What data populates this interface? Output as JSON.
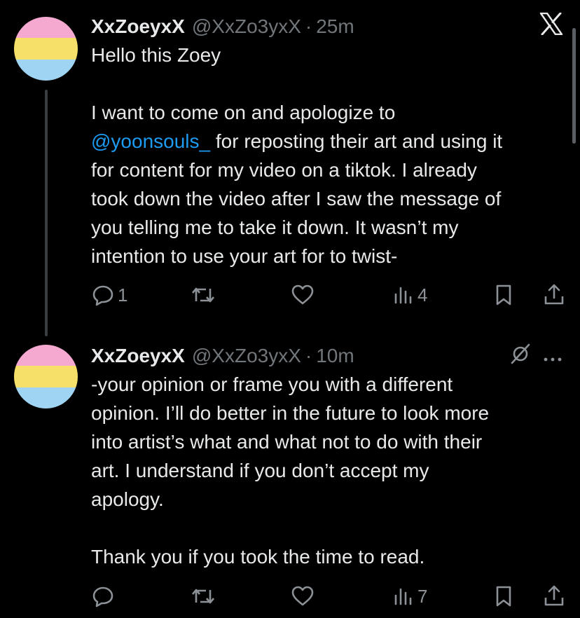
{
  "tweets": [
    {
      "display_name": "XxZoeyxX",
      "handle": "@XxZo3yxX",
      "separator": "·",
      "time": "25m",
      "top_right_icon": "x-logo-icon",
      "text_before_mention": "Hello this Zoey\n\nI want to come on and apologize to\n",
      "mention": "@yoonsouls_",
      "text_after_mention": " for reposting their art and using it\nfor content for my video on a tiktok. I already\ntook down the video after I saw the message of\nyou telling me to take it down. It wasn’t my\nintention to use your art for to twist-",
      "actions": {
        "reply_count": "1",
        "retweet_count": "",
        "like_count": "",
        "views_count": "4"
      }
    },
    {
      "display_name": "XxZoeyxX",
      "handle": "@XxZo3yxX",
      "separator": "·",
      "time": "10m",
      "top_right_icons": [
        "grok-icon",
        "more-icon"
      ],
      "text": "-your opinion or frame you with a different\nopinion. I’ll do better in the future to look more\ninto artist’s what and what not to do with their\nart. I understand if you don’t accept my\napology.\n\nThank you if you took the time to read.",
      "actions": {
        "reply_count": "",
        "retweet_count": "",
        "like_count": "",
        "views_count": "7"
      }
    }
  ],
  "colors": {
    "background": "#000000",
    "text": "#e7e9ea",
    "secondary": "#71767b",
    "mention": "#1d9bf0",
    "avatar_bands": [
      "#f5a8d0",
      "#f7e06a",
      "#9fd4f3"
    ]
  }
}
